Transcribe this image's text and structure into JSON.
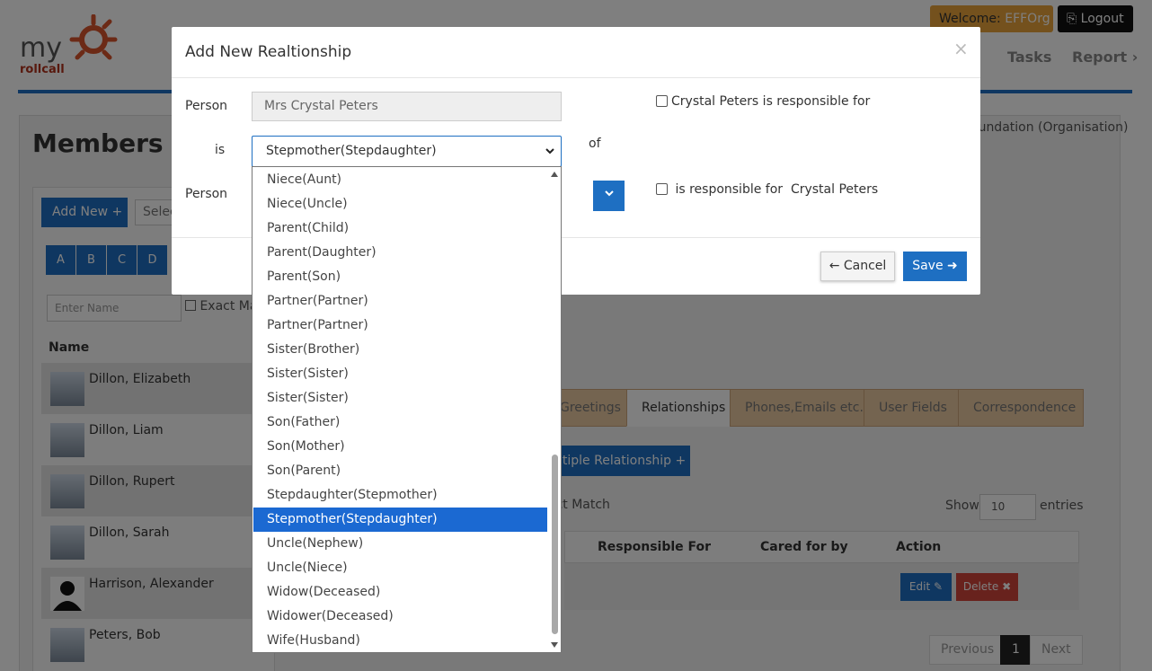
{
  "header": {
    "logo_my": "my",
    "logo_rollcall": "rollcall",
    "welcome_label": "Welcome:",
    "welcome_user": "EFFOrg",
    "logout_label": "Logout",
    "nav": [
      "Tasks",
      "Report ›"
    ]
  },
  "page": {
    "title": "Members :",
    "org_text": "oundation (Organisation)",
    "add_new_label": "Add New",
    "select_placeholder": "Selec",
    "letters": [
      "A",
      "B",
      "C",
      "D"
    ],
    "name_placeholder": "Enter Name",
    "exact_match_label": "Exact Ma",
    "name_header": "Name",
    "members": [
      "Dillon, Elizabeth",
      "Dillon, Liam",
      "Dillon, Rupert",
      "Dillon, Sarah",
      "Harrison, Alexander",
      "Peters, Bob"
    ],
    "tabs": [
      "Greetings",
      "Relationships",
      "Phones,Emails etc.",
      "User Fields",
      "Correspondence"
    ],
    "multiple_rel_label": "ltiple Relationship",
    "exact_match2_label": "act Match",
    "show_label": "Show",
    "show_value": "10",
    "entries_label": "entries",
    "columns": [
      "Responsible For",
      "Cared for by",
      "Action"
    ],
    "edit_label": "Edit",
    "delete_label": "Delete",
    "pager": [
      "Previous",
      "1",
      "Next"
    ]
  },
  "modal": {
    "title": "Add New Realtionship",
    "close": "×",
    "person_label": "Person",
    "person_value": "Mrs Crystal  Peters",
    "is_label": "is",
    "is_value": "Stepmother(Stepdaughter)",
    "of_label": "of",
    "person2_label": "Person",
    "responsible_for_text": "Crystal Peters is responsible for",
    "is_responsible_text": " is responsible for  Crystal Peters",
    "cancel_label": "Cancel",
    "save_label": "Save"
  },
  "dropdown": {
    "options": [
      "Niece(Aunt)",
      "Niece(Uncle)",
      "Parent(Child)",
      "Parent(Daughter)",
      "Parent(Son)",
      "Partner(Partner)",
      "Partner(Partner)",
      "Sister(Brother)",
      "Sister(Sister)",
      "Sister(Sister)",
      "Son(Father)",
      "Son(Mother)",
      "Son(Parent)",
      "Stepdaughter(Stepmother)",
      "Stepmother(Stepdaughter)",
      "Uncle(Nephew)",
      "Uncle(Niece)",
      "Widow(Deceased)",
      "Widower(Deceased)",
      "Wife(Husband)"
    ],
    "selected_index": 14
  },
  "colors": {
    "primary": "#1e6fc2",
    "selected_option": "#1b69d2",
    "danger": "#d0453a",
    "welcome_bg": "#e8a23a",
    "tab_bg": "#e9c9a0"
  }
}
